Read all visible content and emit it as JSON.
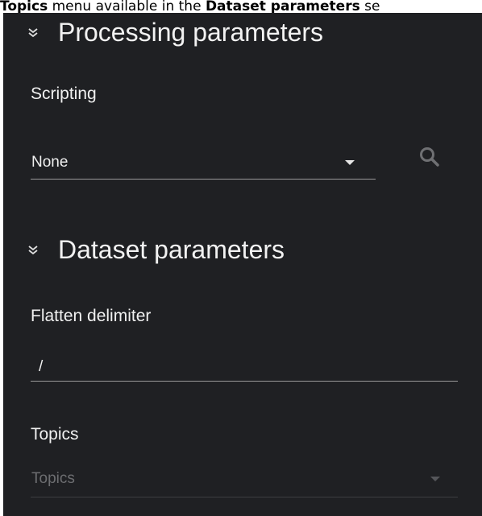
{
  "caption": {
    "part1": "Topics",
    "part2": " menu available in the ",
    "part3": "Dataset parameters",
    "part4": " se"
  },
  "processing": {
    "title": "Processing parameters",
    "scripting_label": "Scripting",
    "scripting_value": "None"
  },
  "dataset": {
    "title": "Dataset parameters",
    "flatten_label": "Flatten delimiter",
    "flatten_value": "/",
    "topics_label": "Topics",
    "topics_placeholder": "Topics"
  },
  "colors": {
    "panel_bg": "#1f2023",
    "text": "#f0f0f0",
    "muted": "#6c6d70",
    "underline": "#9a9a9a"
  },
  "icons": [
    "chevrons-down-icon",
    "caret-down-icon",
    "search-icon"
  ]
}
